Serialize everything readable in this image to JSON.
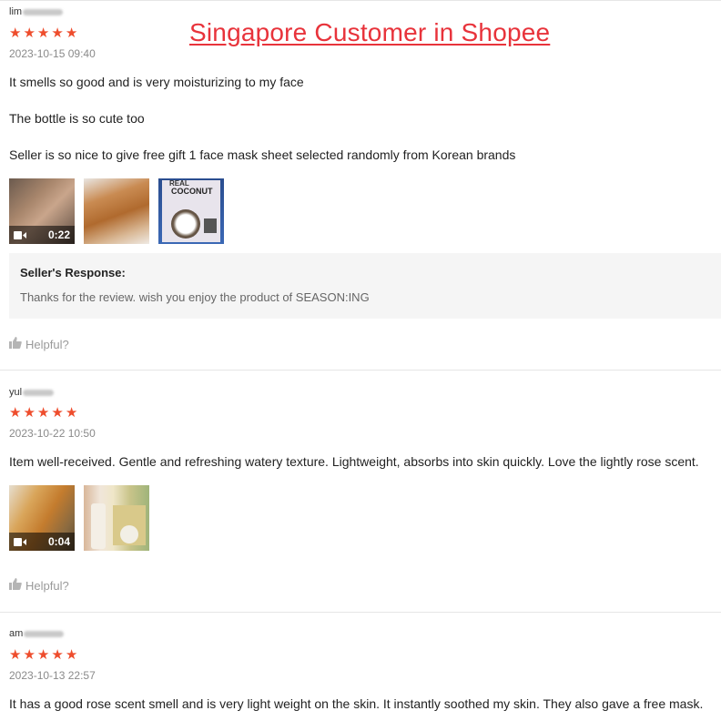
{
  "banner": "Singapore Customer in Shopee",
  "reviews": [
    {
      "username": "lim",
      "rating": 5,
      "timestamp": "2023-10-15 09:40",
      "lines": [
        "It smells so good and is very moisturizing to my face",
        "The bottle is so cute too",
        "Seller is so nice to give free gift 1 face mask sheet selected randomly from Korean brands"
      ],
      "media": [
        {
          "type": "video",
          "duration": "0:22",
          "icon": "video-camera-icon"
        },
        {
          "type": "image"
        },
        {
          "type": "image",
          "label_line1": "REAL",
          "label_line2": "COCONUT"
        }
      ],
      "seller_response": {
        "title": "Seller's Response:",
        "text": "Thanks for the review. wish you enjoy the product of SEASON:ING"
      },
      "helpful_label": "Helpful?"
    },
    {
      "username": "yul",
      "rating": 5,
      "timestamp": "2023-10-22 10:50",
      "lines": [
        "Item well-received.  Gentle and refreshing watery texture. Lightweight, absorbs into skin quickly. Love the lightly rose scent."
      ],
      "media": [
        {
          "type": "video",
          "duration": "0:04",
          "icon": "video-camera-icon"
        },
        {
          "type": "image"
        }
      ],
      "helpful_label": "Helpful?"
    },
    {
      "username": "am",
      "rating": 5,
      "timestamp": "2023-10-13 22:57",
      "lines": [
        "It has a good rose scent smell and is very light weight on the skin. It instantly soothed my skin. They also gave a free mask."
      ]
    }
  ],
  "colors": {
    "star": "#ee4d2d",
    "banner": "#e8333b",
    "response_bg": "#f5f5f5"
  },
  "icons": {
    "star": "star-icon",
    "helpful": "thumbs-up-icon"
  }
}
